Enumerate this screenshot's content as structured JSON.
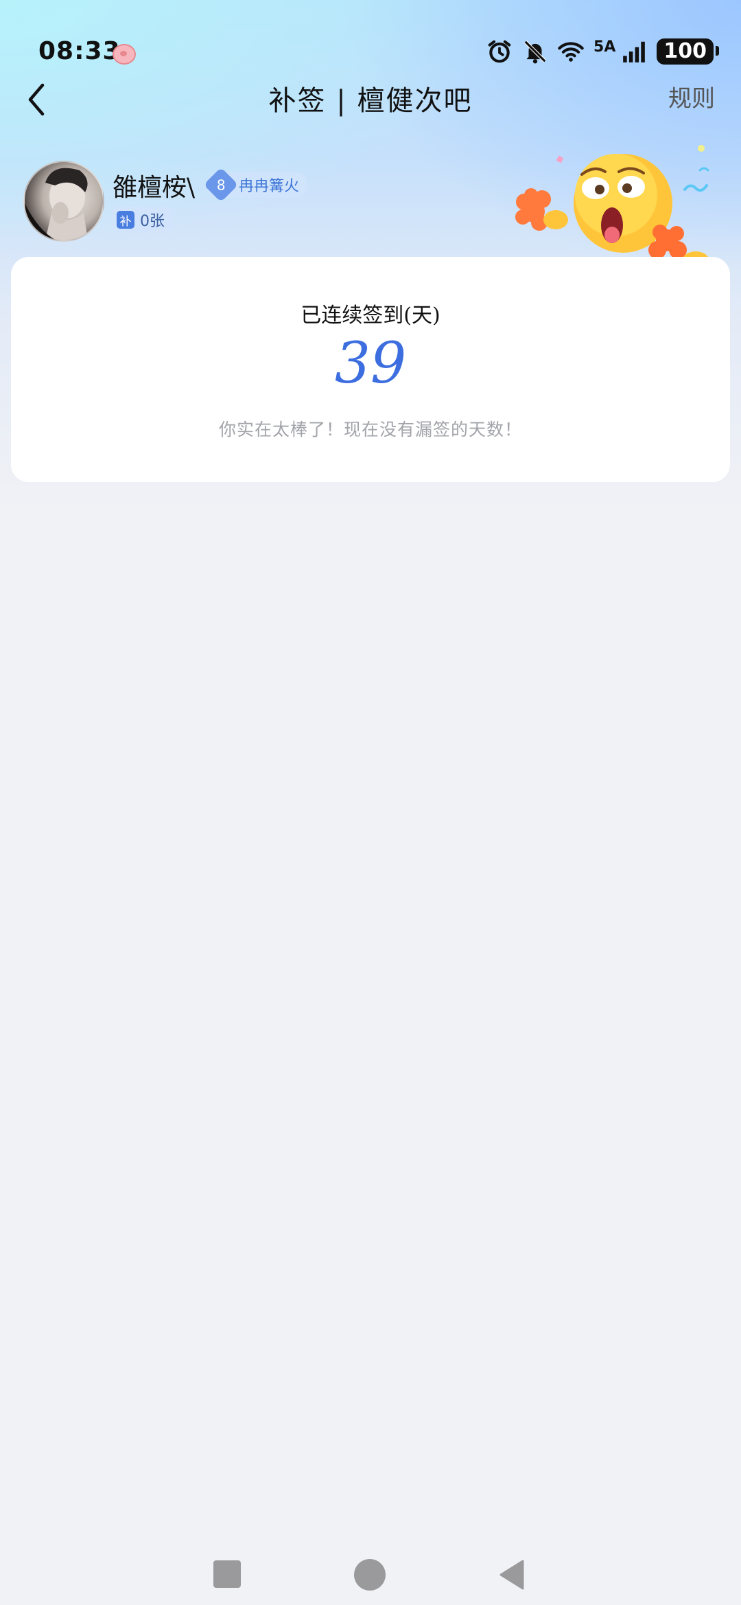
{
  "status_bar": {
    "time": "08:33",
    "network": "5A",
    "battery": "100"
  },
  "nav": {
    "title": "补签 | 檀健次吧",
    "rules": "规则"
  },
  "user": {
    "name": "雒檀桉\\",
    "level": "8",
    "level_title": "冉冉篝火",
    "ticket_icon": "补",
    "ticket_count": "0张"
  },
  "checkin": {
    "label": "已连续签到(天)",
    "count": "39",
    "message": "你实在太棒了！现在没有漏签的天数！"
  },
  "colors": {
    "accent": "#3d6ee0",
    "badge_bg": "#d2e4fc",
    "muted_text": "#a2a4aa"
  }
}
